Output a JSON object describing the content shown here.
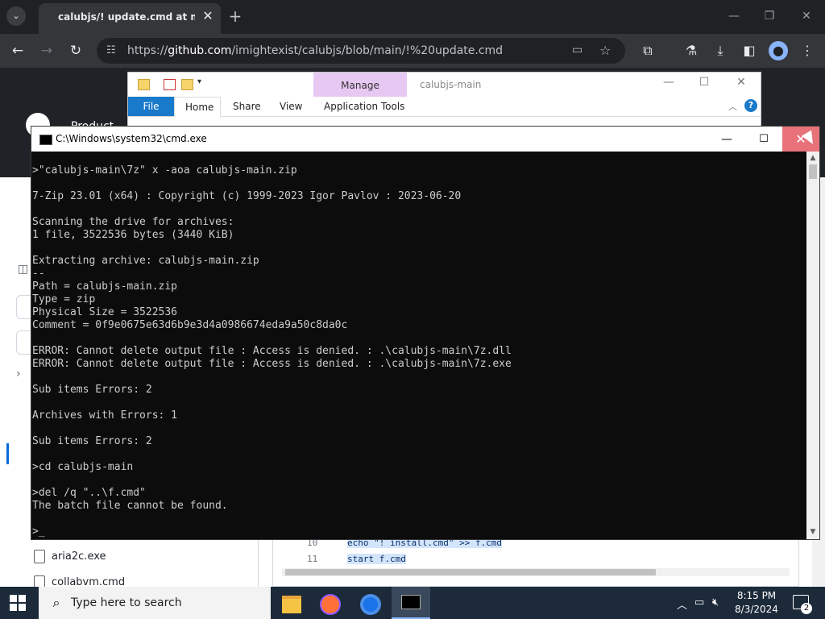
{
  "browser": {
    "tab_title": "calubjs/! update.cmd at main",
    "tab_close": "✕",
    "new_tab": "+",
    "tab_menu": "⌄",
    "url_prefix": "https://",
    "url_host": "github.com",
    "url_path": "/imightexist/calubjs/blob/main/!%20update.cmd",
    "window_controls": [
      "—",
      "❐",
      "✕"
    ]
  },
  "github": {
    "product_label": "Product",
    "files": [
      "aria2c.exe",
      "collabvm.cmd"
    ],
    "code_lines": [
      {
        "num": "10",
        "text": "echo \"! install.cmd\" >> f.cmd"
      },
      {
        "num": "11",
        "text": "start f.cmd"
      }
    ]
  },
  "explorer": {
    "title": "calubjs-main",
    "manage_label": "Manage",
    "tabs": [
      "File",
      "Home",
      "Share",
      "View",
      "Application Tools"
    ],
    "help": "?"
  },
  "cmd": {
    "title": "C:\\Windows\\system32\\cmd.exe",
    "min": "—",
    "max": "☐",
    "close": "✕",
    "output": ">\"calubjs-main\\7z\" x -aoa calubjs-main.zip\n\n7-Zip 23.01 (x64) : Copyright (c) 1999-2023 Igor Pavlov : 2023-06-20\n\nScanning the drive for archives:\n1 file, 3522536 bytes (3440 KiB)\n\nExtracting archive: calubjs-main.zip\n--\nPath = calubjs-main.zip\nType = zip\nPhysical Size = 3522536\nComment = 0f9e0675e63d6b9e3d4a0986674eda9a50c8da0c\n\nERROR: Cannot delete output file : Access is denied. : .\\calubjs-main\\7z.dll\nERROR: Cannot delete output file : Access is denied. : .\\calubjs-main\\7z.exe\n\nSub items Errors: 2\n\nArchives with Errors: 1\n\nSub items Errors: 2\n\n>cd calubjs-main\n\n>del /q \"..\\f.cmd\"\nThe batch file cannot be found.\n\n>_"
  },
  "taskbar": {
    "search_placeholder": "Type here to search",
    "time": "8:15 PM",
    "date": "8/3/2024",
    "notifications": "2"
  },
  "colors": {
    "tabstrip": "#202124",
    "toolbar": "#35363a",
    "console_bg": "#0c0c0c",
    "console_fg": "#cccccc",
    "close_hover": "#e8727a",
    "manage_tab": "#e6c8f2",
    "file_tab": "#1979ca",
    "taskbar": "#1c2a3a"
  }
}
